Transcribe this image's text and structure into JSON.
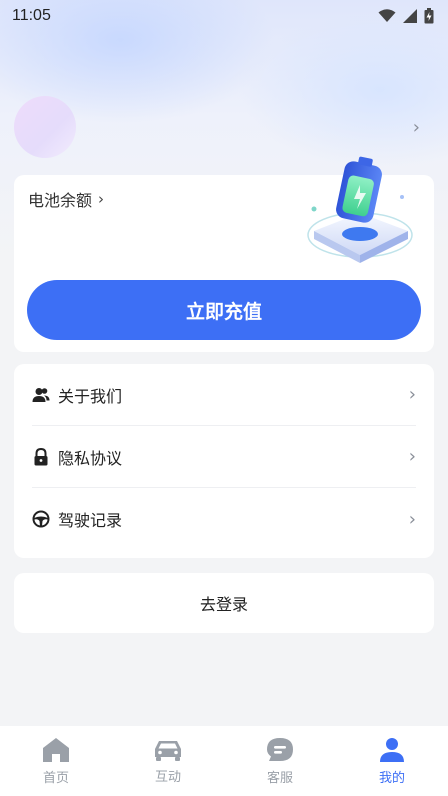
{
  "status_bar": {
    "time": "11:05"
  },
  "balance": {
    "label": "电池余额"
  },
  "recharge": {
    "label": "立即充值"
  },
  "menu": [
    {
      "label": "关于我们",
      "icon": "users-icon"
    },
    {
      "label": "隐私协议",
      "icon": "lock-icon"
    },
    {
      "label": "驾驶记录",
      "icon": "steering-wheel-icon"
    }
  ],
  "login": {
    "label": "去登录"
  },
  "tabs": [
    {
      "label": "首页",
      "icon": "home-icon",
      "active": false
    },
    {
      "label": "互动",
      "icon": "car-icon",
      "active": false
    },
    {
      "label": "客服",
      "icon": "chat-icon",
      "active": false
    },
    {
      "label": "我的",
      "icon": "user-icon",
      "active": true
    }
  ],
  "colors": {
    "accent": "#3d6ff5",
    "tab_inactive": "#9aa0a8"
  }
}
